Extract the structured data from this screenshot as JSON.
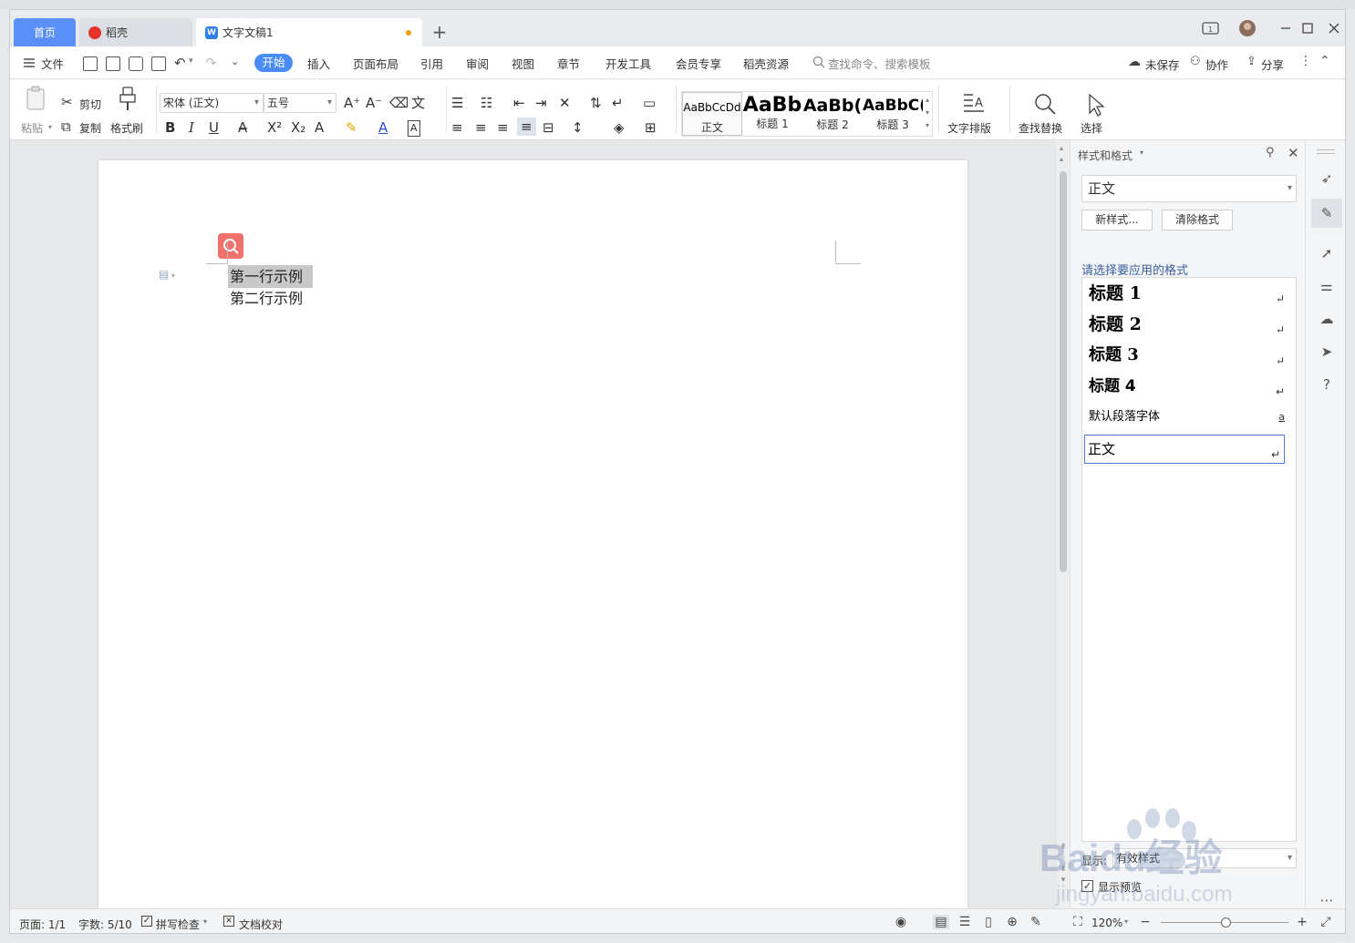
{
  "tabs": [
    {
      "label": "首页"
    },
    {
      "label": "稻壳"
    },
    {
      "label": "文字文稿1"
    }
  ],
  "menu": {
    "file": "文件",
    "items": [
      "开始",
      "插入",
      "页面布局",
      "引用",
      "审阅",
      "视图",
      "章节",
      "开发工具",
      "会员专享",
      "稻壳资源"
    ],
    "search_placeholder": "查找命令、搜索模板",
    "right": [
      "未保存",
      "协作",
      "分享"
    ]
  },
  "toolbar": {
    "paste": "粘贴",
    "cut": "剪切",
    "copy": "复制",
    "format_painter": "格式刷",
    "font_name": "宋体 (正文)",
    "font_size": "五号",
    "style_gallery": [
      {
        "sample": "AaBbCcDd",
        "name": "正文"
      },
      {
        "sample": "AaBb",
        "name": "标题 1"
      },
      {
        "sample": "AaBb(",
        "name": "标题 2"
      },
      {
        "sample": "AaBbC(",
        "name": "标题 3"
      }
    ],
    "text_layout": "文字排版",
    "find_replace": "查找替换",
    "select": "选择"
  },
  "document": {
    "lines": [
      "第一行示例",
      "第二行示例"
    ]
  },
  "side_panel": {
    "title": "样式和格式",
    "current_style": "正文",
    "new_style_button": "新样式...",
    "clear_format_button": "清除格式",
    "section_label": "请选择要应用的格式",
    "styles": [
      {
        "label": "标题  1",
        "mark": "↵"
      },
      {
        "label": "标题  2",
        "mark": "↵"
      },
      {
        "label": "标题  3",
        "mark": "↵"
      },
      {
        "label": "标题  4",
        "mark": "↵"
      },
      {
        "label": "默认段落字体",
        "mark": "a"
      },
      {
        "label": "正文",
        "mark": "↵"
      }
    ],
    "show_label": "显示:",
    "show_value": "有效样式",
    "preview_label": "显示预览",
    "preview_checked": true
  },
  "status": {
    "page": "页面: 1/1",
    "words": "字数: 5/10",
    "spell": "拼写检查",
    "proof": "文档校对",
    "zoom": "120%"
  },
  "watermark": {
    "text": "Baidu经验",
    "url": "jingyan.baidu.com"
  },
  "colors": {
    "accent": "#4a8cf7",
    "tab_home": "#5b8ff9",
    "selection": "#c8c8c8",
    "search_float": "#f0716b"
  }
}
